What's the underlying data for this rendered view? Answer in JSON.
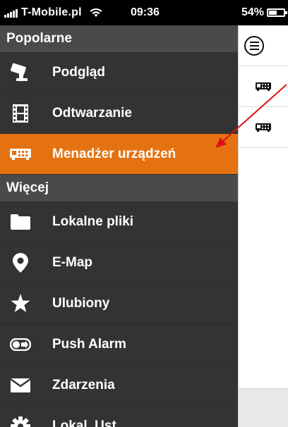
{
  "status_bar": {
    "carrier": "T-Mobile.pl",
    "time": "09:36",
    "battery": "54%"
  },
  "menu": {
    "sections": [
      {
        "title": "Popolarne",
        "items": [
          {
            "label": "Podgląd",
            "icon": "camera-icon"
          },
          {
            "label": "Odtwarzanie",
            "icon": "film-icon"
          },
          {
            "label": "Menadżer urządzeń",
            "icon": "dvr-device-icon",
            "active": true
          }
        ]
      },
      {
        "title": "Więcej",
        "items": [
          {
            "label": "Lokalne pliki",
            "icon": "folder-icon"
          },
          {
            "label": "E-Map",
            "icon": "map-pin-icon"
          },
          {
            "label": "Ulubiony",
            "icon": "star-icon"
          },
          {
            "label": "Push Alarm",
            "icon": "toggle-icon"
          },
          {
            "label": "Zdarzenia",
            "icon": "envelope-icon"
          },
          {
            "label": "Lokal. Ust.",
            "icon": "gear-icon"
          }
        ]
      }
    ]
  },
  "colors": {
    "menu_background": "#333333",
    "section_header": "#4a4a4a",
    "active_item": "#e57211",
    "annotation_arrow": "#e01010"
  }
}
